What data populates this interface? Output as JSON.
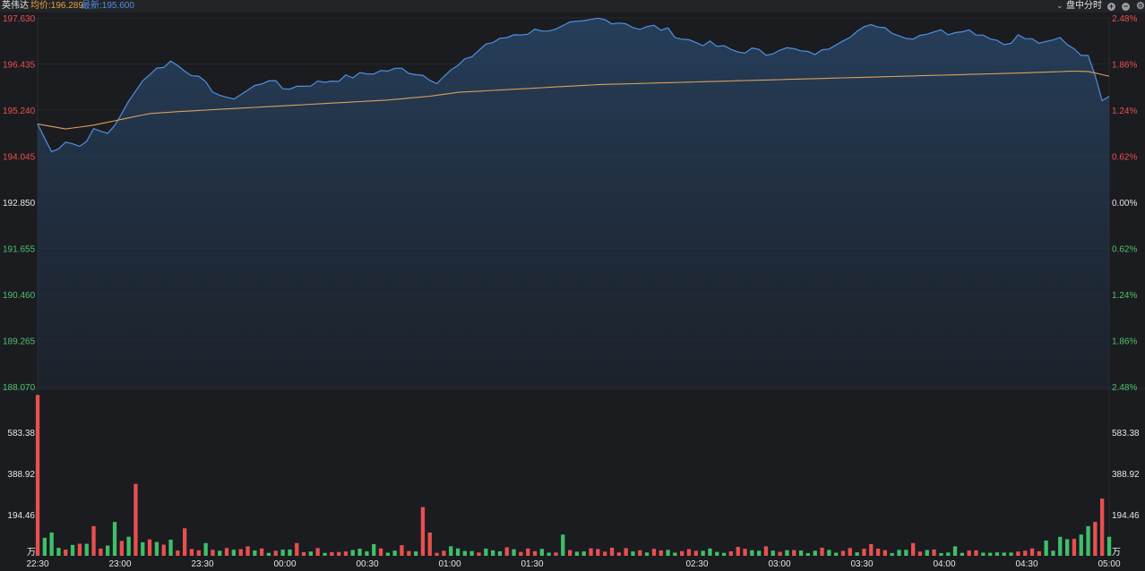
{
  "header": {
    "stock_name": "英伟达",
    "avg_label": "均价:196.289",
    "latest_label": "最新:195.600",
    "mode_label": "盘中分时",
    "icons": [
      "zoom-in-icon",
      "zoom-out-icon",
      "gear-icon"
    ]
  },
  "colors": {
    "background": "#1b1c20",
    "price_line": "#4f8fe0",
    "avg_line": "#d9a05b",
    "up": "#e85050",
    "down": "#3fbf6a",
    "neutral": "#dddddd"
  },
  "chart_data": {
    "type": "line",
    "title": "",
    "x_ticks": [
      "22:30",
      "23:00",
      "23:30",
      "00:00",
      "00:30",
      "01:00",
      "01:30",
      "",
      "02:30",
      "03:00",
      "03:30",
      "04:00",
      "04:30",
      "05:00"
    ],
    "price_axis": {
      "labels": [
        "197.630",
        "196.435",
        "195.240",
        "194.045",
        "192.850",
        "191.655",
        "190.460",
        "189.265",
        "188.070"
      ],
      "ylim": [
        188.07,
        197.63
      ],
      "base": 192.85
    },
    "pct_axis": {
      "labels": [
        "2.48%",
        "1.86%",
        "1.24%",
        "0.62%",
        "0.00%",
        "0.62%",
        "1.24%",
        "1.86%",
        "2.48%"
      ]
    },
    "volume_axis": {
      "labels": [
        "583.38",
        "388.92",
        "194.46"
      ],
      "unit": "万",
      "ylim": [
        0,
        778
      ]
    },
    "price_keypoints": [
      [
        0,
        194.88
      ],
      [
        2,
        194.15
      ],
      [
        4,
        194.45
      ],
      [
        6,
        194.3
      ],
      [
        8,
        194.7
      ],
      [
        10,
        194.65
      ],
      [
        12,
        195.1
      ],
      [
        14,
        195.8
      ],
      [
        16,
        196.2
      ],
      [
        19,
        196.5
      ],
      [
        22,
        196.2
      ],
      [
        24,
        195.9
      ],
      [
        27,
        195.5
      ],
      [
        29,
        195.65
      ],
      [
        31,
        195.85
      ],
      [
        33,
        196.05
      ],
      [
        35,
        195.8
      ],
      [
        37,
        195.85
      ],
      [
        40,
        195.95
      ],
      [
        43,
        196.05
      ],
      [
        46,
        196.15
      ],
      [
        49,
        196.25
      ],
      [
        52,
        196.3
      ],
      [
        55,
        196.15
      ],
      [
        57,
        196.0
      ],
      [
        59,
        196.25
      ],
      [
        61,
        196.5
      ],
      [
        63,
        196.8
      ],
      [
        64,
        196.95
      ],
      [
        66,
        197.05
      ],
      [
        68,
        197.2
      ],
      [
        70,
        197.25
      ],
      [
        72,
        197.35
      ],
      [
        74,
        197.3
      ],
      [
        76,
        197.45
      ],
      [
        78,
        197.5
      ],
      [
        80,
        197.6
      ],
      [
        82,
        197.55
      ],
      [
        84,
        197.5
      ],
      [
        86,
        197.35
      ],
      [
        88,
        197.4
      ],
      [
        90,
        197.3
      ],
      [
        92,
        197.1
      ],
      [
        94,
        197.0
      ],
      [
        96,
        196.95
      ],
      [
        98,
        196.85
      ],
      [
        100,
        196.75
      ],
      [
        102,
        196.8
      ],
      [
        104,
        196.7
      ],
      [
        106,
        196.85
      ],
      [
        108,
        196.8
      ],
      [
        110,
        196.7
      ],
      [
        112,
        196.75
      ],
      [
        114,
        197.0
      ],
      [
        116,
        197.2
      ],
      [
        118,
        197.35
      ],
      [
        120,
        197.45
      ],
      [
        122,
        197.3
      ],
      [
        124,
        197.1
      ],
      [
        126,
        197.2
      ],
      [
        128,
        197.3
      ],
      [
        130,
        197.25
      ],
      [
        132,
        197.35
      ],
      [
        134,
        197.25
      ],
      [
        136,
        197.15
      ],
      [
        138,
        196.95
      ],
      [
        140,
        197.15
      ],
      [
        142,
        197.05
      ],
      [
        144,
        196.95
      ],
      [
        146,
        197.1
      ],
      [
        148,
        196.85
      ],
      [
        150,
        196.6
      ],
      [
        151,
        196.2
      ],
      [
        152,
        195.55
      ],
      [
        153,
        195.6
      ]
    ],
    "avg_keypoints": [
      [
        0,
        194.88
      ],
      [
        4,
        194.75
      ],
      [
        8,
        194.85
      ],
      [
        12,
        195.0
      ],
      [
        16,
        195.15
      ],
      [
        20,
        195.2
      ],
      [
        25,
        195.25
      ],
      [
        30,
        195.3
      ],
      [
        40,
        195.4
      ],
      [
        50,
        195.5
      ],
      [
        56,
        195.6
      ],
      [
        60,
        195.7
      ],
      [
        70,
        195.8
      ],
      [
        80,
        195.9
      ],
      [
        90,
        195.95
      ],
      [
        100,
        196.0
      ],
      [
        110,
        196.05
      ],
      [
        120,
        196.1
      ],
      [
        130,
        196.15
      ],
      [
        140,
        196.2
      ],
      [
        148,
        196.25
      ],
      [
        150,
        196.24
      ],
      [
        153,
        196.12
      ]
    ],
    "volume_spikes": [
      [
        0,
        760,
        "u"
      ],
      [
        1,
        85,
        "d"
      ],
      [
        2,
        110,
        "d"
      ],
      [
        8,
        140,
        "u"
      ],
      [
        10,
        48,
        "d"
      ],
      [
        11,
        160,
        "d"
      ],
      [
        12,
        70,
        "u"
      ],
      [
        13,
        90,
        "d"
      ],
      [
        14,
        340,
        "u"
      ],
      [
        17,
        65,
        "d"
      ],
      [
        21,
        130,
        "u"
      ],
      [
        24,
        60,
        "d"
      ],
      [
        30,
        45,
        "u"
      ],
      [
        37,
        60,
        "u"
      ],
      [
        48,
        55,
        "d"
      ],
      [
        52,
        50,
        "u"
      ],
      [
        55,
        230,
        "u"
      ],
      [
        56,
        110,
        "u"
      ],
      [
        59,
        45,
        "d"
      ],
      [
        67,
        40,
        "u"
      ],
      [
        75,
        100,
        "d"
      ],
      [
        82,
        38,
        "u"
      ],
      [
        100,
        42,
        "u"
      ],
      [
        104,
        45,
        "u"
      ],
      [
        112,
        38,
        "u"
      ],
      [
        119,
        55,
        "u"
      ],
      [
        125,
        60,
        "u"
      ],
      [
        131,
        45,
        "d"
      ],
      [
        144,
        72,
        "d"
      ],
      [
        148,
        80,
        "u"
      ],
      [
        149,
        100,
        "d"
      ],
      [
        150,
        140,
        "d"
      ],
      [
        151,
        160,
        "u"
      ],
      [
        152,
        270,
        "u"
      ],
      [
        153,
        90,
        "d"
      ]
    ]
  }
}
